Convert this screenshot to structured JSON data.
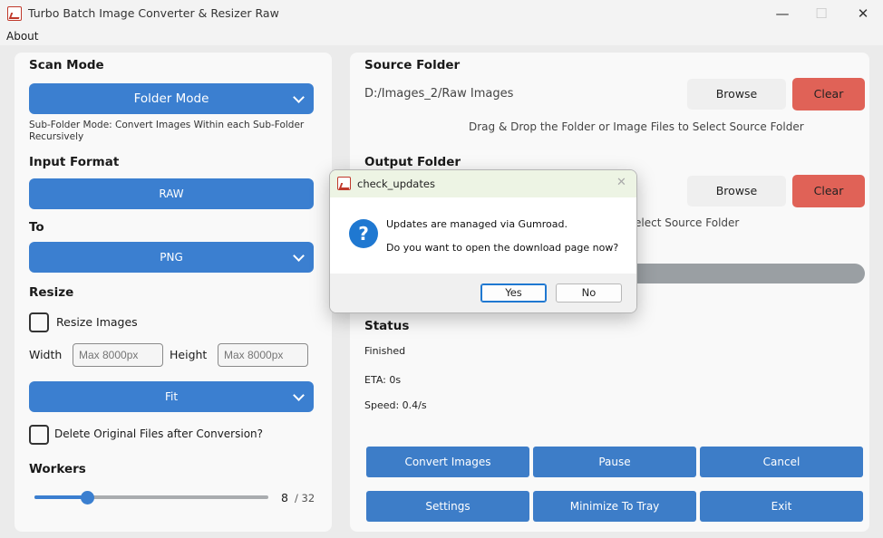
{
  "window": {
    "title": "Turbo Batch Image Converter & Resizer Raw",
    "minimize_glyph": "—",
    "maximize_glyph": "☐",
    "close_glyph": "✕"
  },
  "menu": {
    "about": "About"
  },
  "left": {
    "scan_mode_title": "Scan Mode",
    "scan_mode_value": "Folder Mode",
    "scan_mode_hint": "Sub-Folder Mode: Convert Images Within each Sub-Folder Recursively",
    "input_format_title": "Input Format",
    "input_format_value": "RAW",
    "to_title": "To",
    "to_value": "PNG",
    "resize_title": "Resize",
    "resize_images_label": "Resize Images",
    "width_label": "Width",
    "width_placeholder": "Max 8000px",
    "height_label": "Height",
    "height_placeholder": "Max 8000px",
    "fit_value": "Fit",
    "delete_label": "Delete Original Files after Conversion?",
    "workers_title": "Workers",
    "workers_value": "8",
    "workers_max": "/ 32",
    "workers_fraction": 0.25
  },
  "right": {
    "source_title": "Source Folder",
    "source_path": "D:/Images_2/Raw Images",
    "browse_label": "Browse",
    "clear_label": "Clear",
    "source_hint": "Drag & Drop the Folder or Image Files to Select Source Folder",
    "output_title": "Output Folder",
    "output_browse_label": "Browse",
    "output_clear_label": "Clear",
    "output_hint_partial": "elect Source Folder",
    "status_title": "Status",
    "status_value": "Finished",
    "eta": "ETA: 0s",
    "speed": "Speed: 0.4/s",
    "buttons": {
      "convert": "Convert Images",
      "pause": "Pause",
      "cancel": "Cancel",
      "settings": "Settings",
      "minimize": "Minimize To Tray",
      "exit": "Exit"
    }
  },
  "dialog": {
    "title": "check_updates",
    "icon": "question-icon",
    "line1": "Updates are managed via Gumroad.",
    "line2": "Do you want to open the download page now?",
    "yes": "Yes",
    "no": "No",
    "close_glyph": "✕"
  },
  "colors": {
    "accent_blue": "#3b7fd0",
    "clear_red": "#e06257",
    "progress_grey": "#9a9fa3"
  }
}
